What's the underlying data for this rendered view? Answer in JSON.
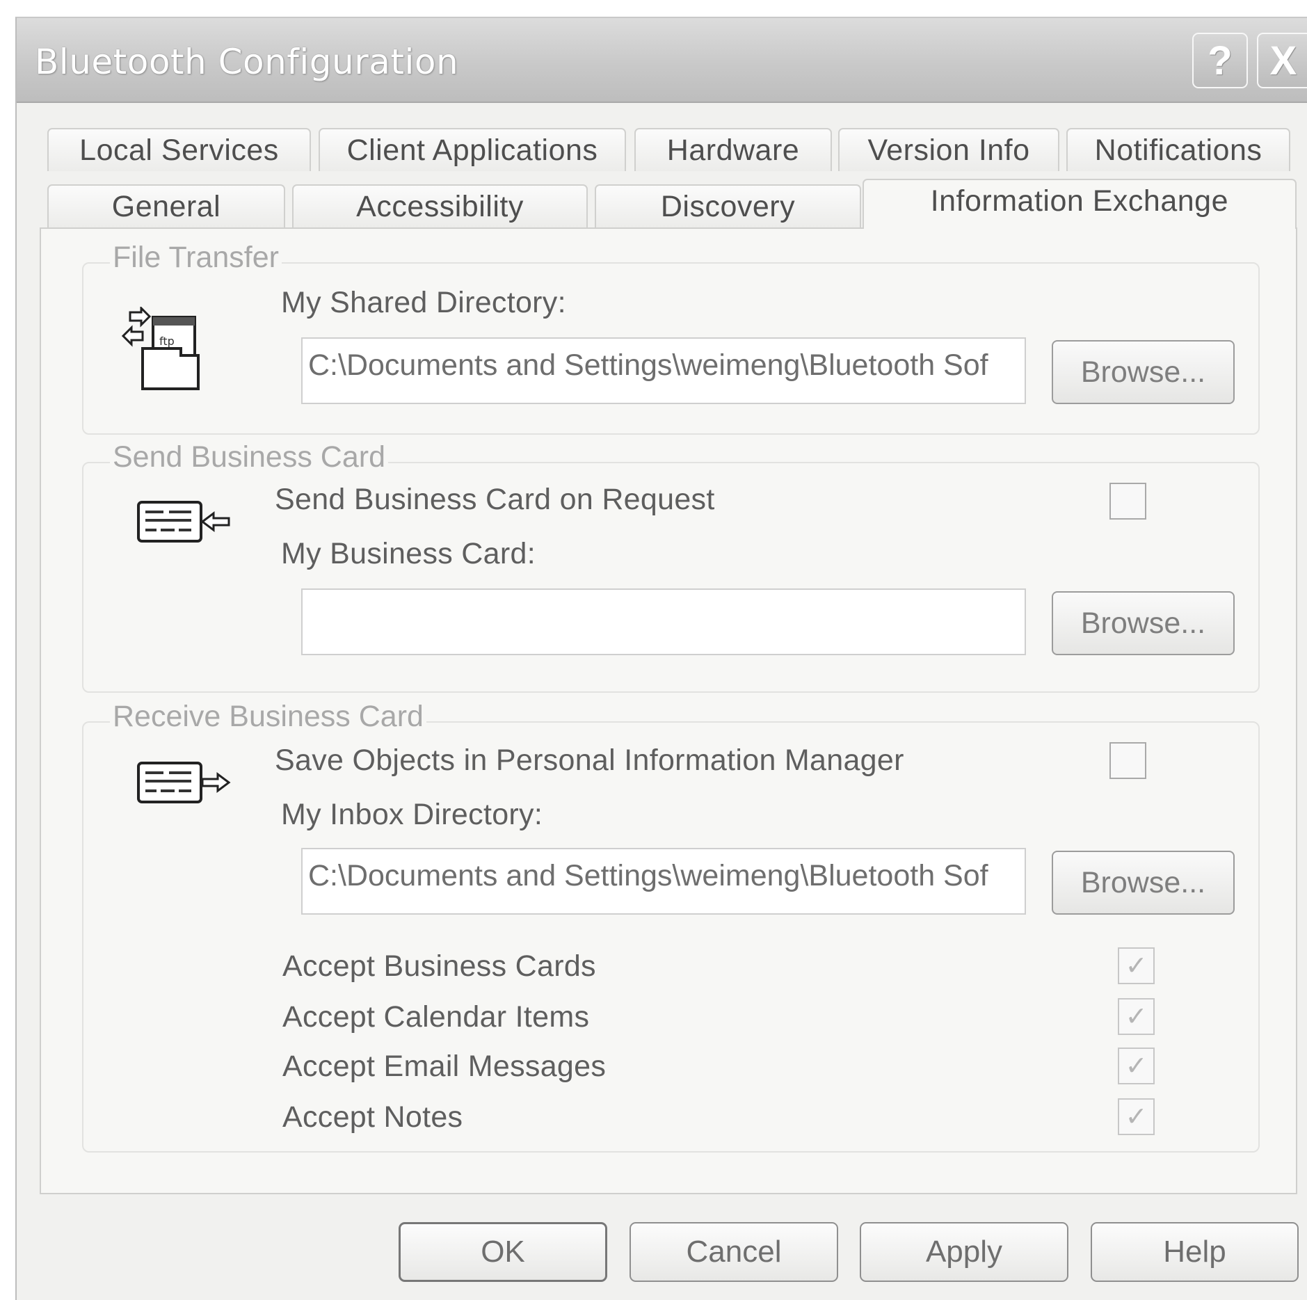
{
  "window": {
    "title": "Bluetooth Configuration"
  },
  "title_buttons": {
    "help": "?",
    "close": "X"
  },
  "tabs_row1": [
    "Local Services",
    "Client Applications",
    "Hardware",
    "Version Info",
    "Notifications"
  ],
  "tabs_row2": [
    "General",
    "Accessibility",
    "Discovery",
    "Information Exchange"
  ],
  "active_tab": "Information Exchange",
  "file_transfer": {
    "group_label": "File Transfer",
    "shared_dir_label": "My Shared Directory:",
    "shared_dir_value": "C:\\Documents and Settings\\weimeng\\Bluetooth Sof",
    "browse_label": "Browse..."
  },
  "send_card": {
    "group_label": "Send Business Card",
    "on_request_label": "Send Business Card on Request",
    "on_request_checked": false,
    "my_card_label": "My Business Card:",
    "my_card_value": "",
    "browse_label": "Browse..."
  },
  "receive_card": {
    "group_label": "Receive Business Card",
    "save_pim_label": "Save Objects in Personal Information Manager",
    "save_pim_checked": false,
    "inbox_label": "My Inbox Directory:",
    "inbox_value": "C:\\Documents and Settings\\weimeng\\Bluetooth Sof",
    "browse_label": "Browse...",
    "accept_items": [
      {
        "label": "Accept Business Cards",
        "checked": true
      },
      {
        "label": "Accept Calendar Items",
        "checked": true
      },
      {
        "label": "Accept Email Messages",
        "checked": true
      },
      {
        "label": "Accept Notes",
        "checked": true
      }
    ]
  },
  "buttons": {
    "ok": "OK",
    "cancel": "Cancel",
    "apply": "Apply",
    "help": "Help"
  },
  "check_glyph": "✓",
  "colors": {
    "titlebar": "#c9c9c9",
    "panel": "#f7f7f5",
    "group_label": "#a8a8a8"
  }
}
